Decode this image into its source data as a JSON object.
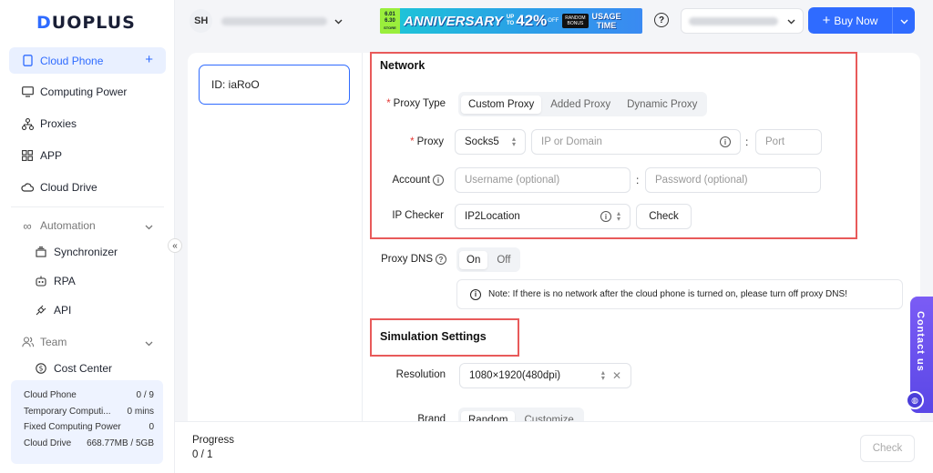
{
  "brand": {
    "logo_prefix": "D",
    "logo_rest": "UOPLUS"
  },
  "sidebar": {
    "items": [
      {
        "label": "Cloud Phone",
        "icon": "phone-icon"
      },
      {
        "label": "Computing Power",
        "icon": "monitor-icon"
      },
      {
        "label": "Proxies",
        "icon": "network-icon"
      },
      {
        "label": "APP",
        "icon": "apps-grid-icon"
      },
      {
        "label": "Cloud Drive",
        "icon": "cloud-icon"
      }
    ],
    "automation": {
      "label": "Automation",
      "children": [
        "Synchronizer",
        "RPA",
        "API"
      ]
    },
    "team": {
      "label": "Team",
      "children": [
        "Cost Center"
      ]
    },
    "stats": [
      {
        "label": "Cloud Phone",
        "value": "0 / 9"
      },
      {
        "label": "Temporary Computi...",
        "value": "0 mins"
      },
      {
        "label": "Fixed Computing Power",
        "value": "0"
      },
      {
        "label": "Cloud Drive",
        "value": "668.77MB / 5GB"
      }
    ],
    "collapse_glyph": "«"
  },
  "header": {
    "avatar": "SH",
    "banner": {
      "date_top": "6.01",
      "date_bottom": "6.30",
      "date_sub": "STORE",
      "title": "ANNIVERSARY",
      "upto_1": "UP",
      "upto_2": "TO",
      "percent": "42%",
      "off": "OFF",
      "random_1": "RANDOM",
      "random_2": "BONUS",
      "usage_1": "USAGE",
      "usage_2": "TIME"
    },
    "help": "?",
    "buy_label": "Buy Now"
  },
  "instance": {
    "id_label": "ID: iaRoO"
  },
  "network": {
    "title": "Network",
    "proxy_type_label": "Proxy Type",
    "proxy_type_options": [
      "Custom Proxy",
      "Added Proxy",
      "Dynamic Proxy"
    ],
    "proxy_label": "Proxy",
    "protocol": "Socks5",
    "host_placeholder": "IP or Domain",
    "port_placeholder": "Port",
    "account_label": "Account",
    "username_placeholder": "Username (optional)",
    "password_placeholder": "Password (optional)",
    "ip_checker_label": "IP Checker",
    "ip_checker_value": "IP2Location",
    "check_button": "Check",
    "colon": ":"
  },
  "proxy_dns": {
    "label": "Proxy DNS",
    "options": [
      "On",
      "Off"
    ],
    "note": "Note: If there is no network after the cloud phone is turned on, please turn off proxy DNS!"
  },
  "simulation": {
    "title": "Simulation Settings",
    "resolution_label": "Resolution",
    "resolution_value": "1080×1920(480dpi)",
    "brand_label": "Brand",
    "brand_options": [
      "Random",
      "Customize"
    ]
  },
  "footer": {
    "progress_label": "Progress",
    "progress_value": "0 / 1",
    "check_button": "Check"
  },
  "contact": {
    "label": "Contact us"
  },
  "colors": {
    "accent": "#2f6bff",
    "highlight": "#e85a5a",
    "contact": "#6a52f0"
  }
}
